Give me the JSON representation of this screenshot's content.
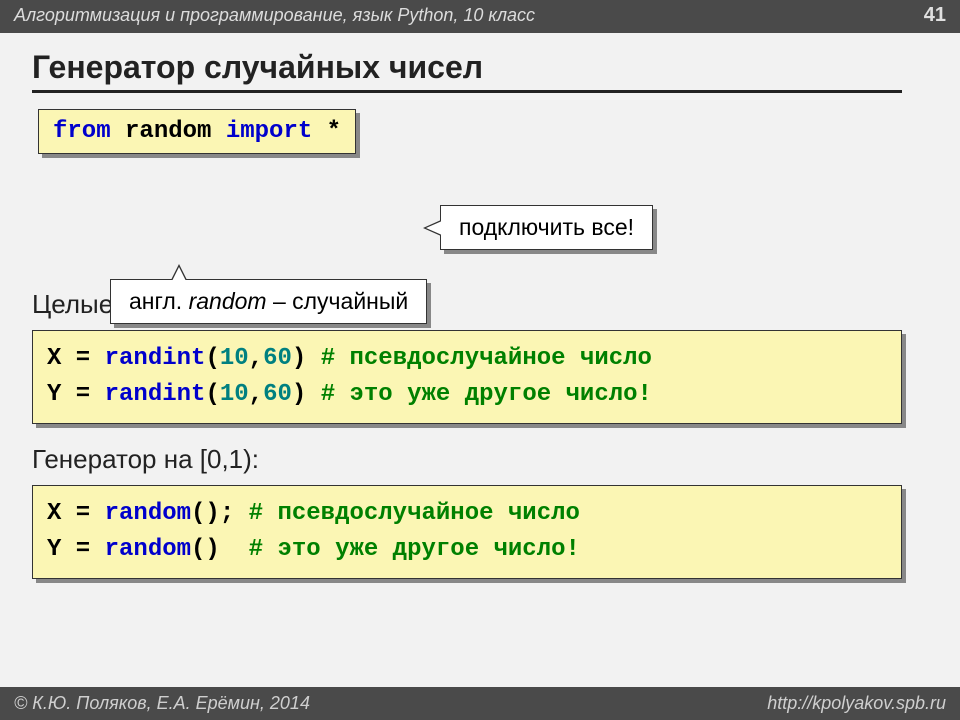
{
  "header": {
    "course": "Алгоритмизация и программирование, язык Python, 10 класс",
    "page": "41"
  },
  "title": "Генератор случайных чисел",
  "import_code": {
    "kw_from": "from",
    "module": "random",
    "kw_import": "import",
    "star": "*"
  },
  "callouts": {
    "connect_all": "подключить все!",
    "random_translation_pre": "англ. ",
    "random_translation_ital": "random",
    "random_translation_post": " – случайный"
  },
  "section1": {
    "heading": "Целые числа на отрезке [a,b]:",
    "line1": {
      "lhs": "X = ",
      "fn": "randint",
      "lp": "(",
      "a1": "10",
      "c": ",",
      "a2": "60",
      "rp": ")",
      "sp": " ",
      "cmt": "# псевдослучайное число"
    },
    "line2": {
      "lhs": "Y = ",
      "fn": "randint",
      "lp": "(",
      "a1": "10",
      "c": ",",
      "a2": "60",
      "rp": ")",
      "sp": " ",
      "cmt": "# это уже другое число!"
    }
  },
  "section2": {
    "heading": "Генератор на [0,1):",
    "line1": {
      "lhs": "X = ",
      "fn": "random",
      "call": "();",
      "pad": " ",
      "cmt": "# псевдослучайное число"
    },
    "line2": {
      "lhs": "Y = ",
      "fn": "random",
      "call": "()",
      "pad": "  ",
      "cmt": "# это уже другое число!"
    }
  },
  "footer": {
    "authors": "© К.Ю. Поляков, Е.А. Ерёмин, 2014",
    "url": "http://kpolyakov.spb.ru"
  }
}
